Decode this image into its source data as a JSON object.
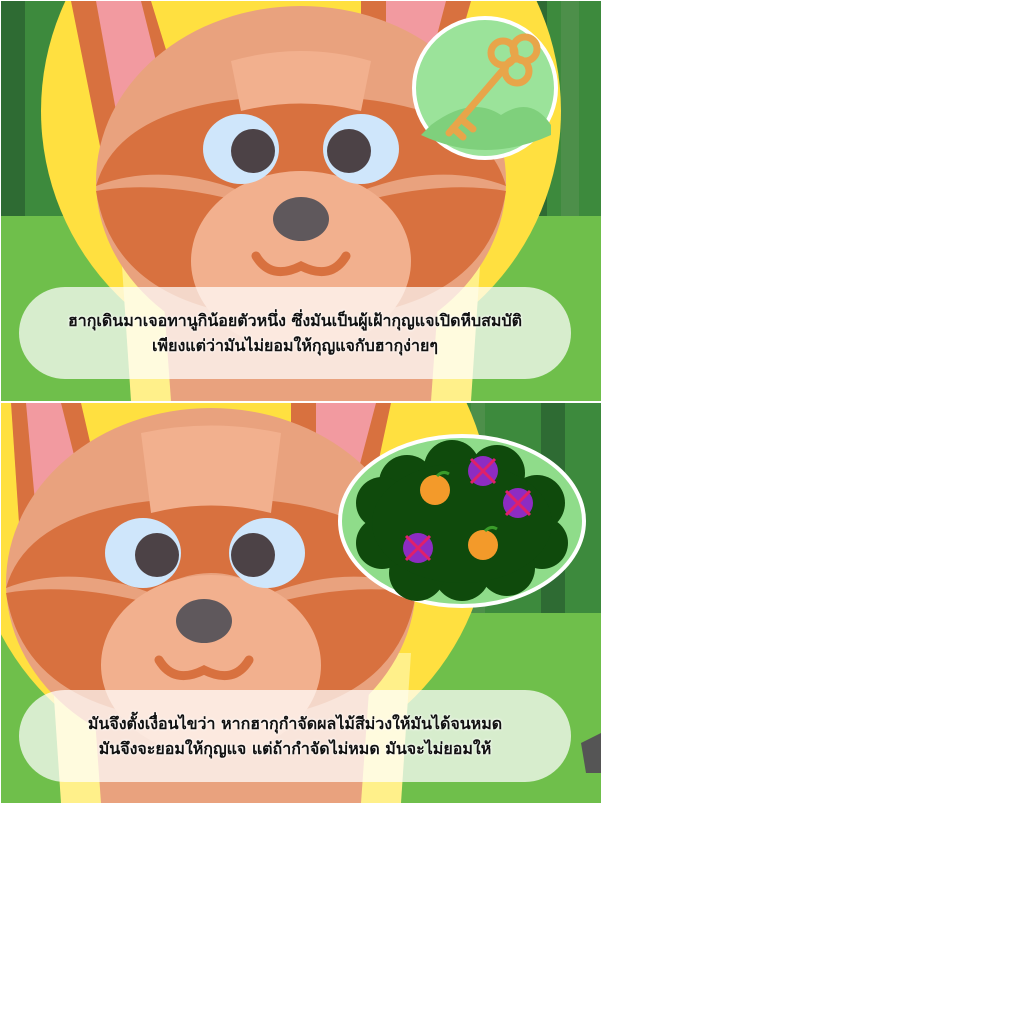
{
  "panels": [
    {
      "inset": "golden-key-icon",
      "caption_lines": [
        "ฮากุเดินมาเจอทานูกิน้อยตัวหนึ่ง ซึ่งมันเป็นผู้เฝ้ากุญแจเปิดหีบสมบัติ",
        "เพียงแต่ว่ามันไม่ยอมให้กุญแจกับฮากุง่ายๆ"
      ]
    },
    {
      "inset": "fruit-bush-icon",
      "caption_lines": [
        "มันจึงตั้งเงื่อนไขว่า หากฮากุกำจัดผลไม้สีม่วงให้มันได้จนหมด",
        "มันจึงจะยอมให้กุญแจ แต่ถ้ากำจัดไม่หมด มันจะไม่ยอมให้"
      ]
    }
  ],
  "colors": {
    "fur_light": "#e9a27e",
    "fur_dark": "#d8713f",
    "ear_pink": "#f29aa0",
    "sun_yellow": "#ffe040",
    "grass": "#6fbf4b",
    "key_gold": "#e8a54a",
    "orange_fruit": "#f39a2a",
    "purple_fruit": "#8d2cc2",
    "cross_red": "#e0206a",
    "bush_green": "#0f4a0c"
  }
}
